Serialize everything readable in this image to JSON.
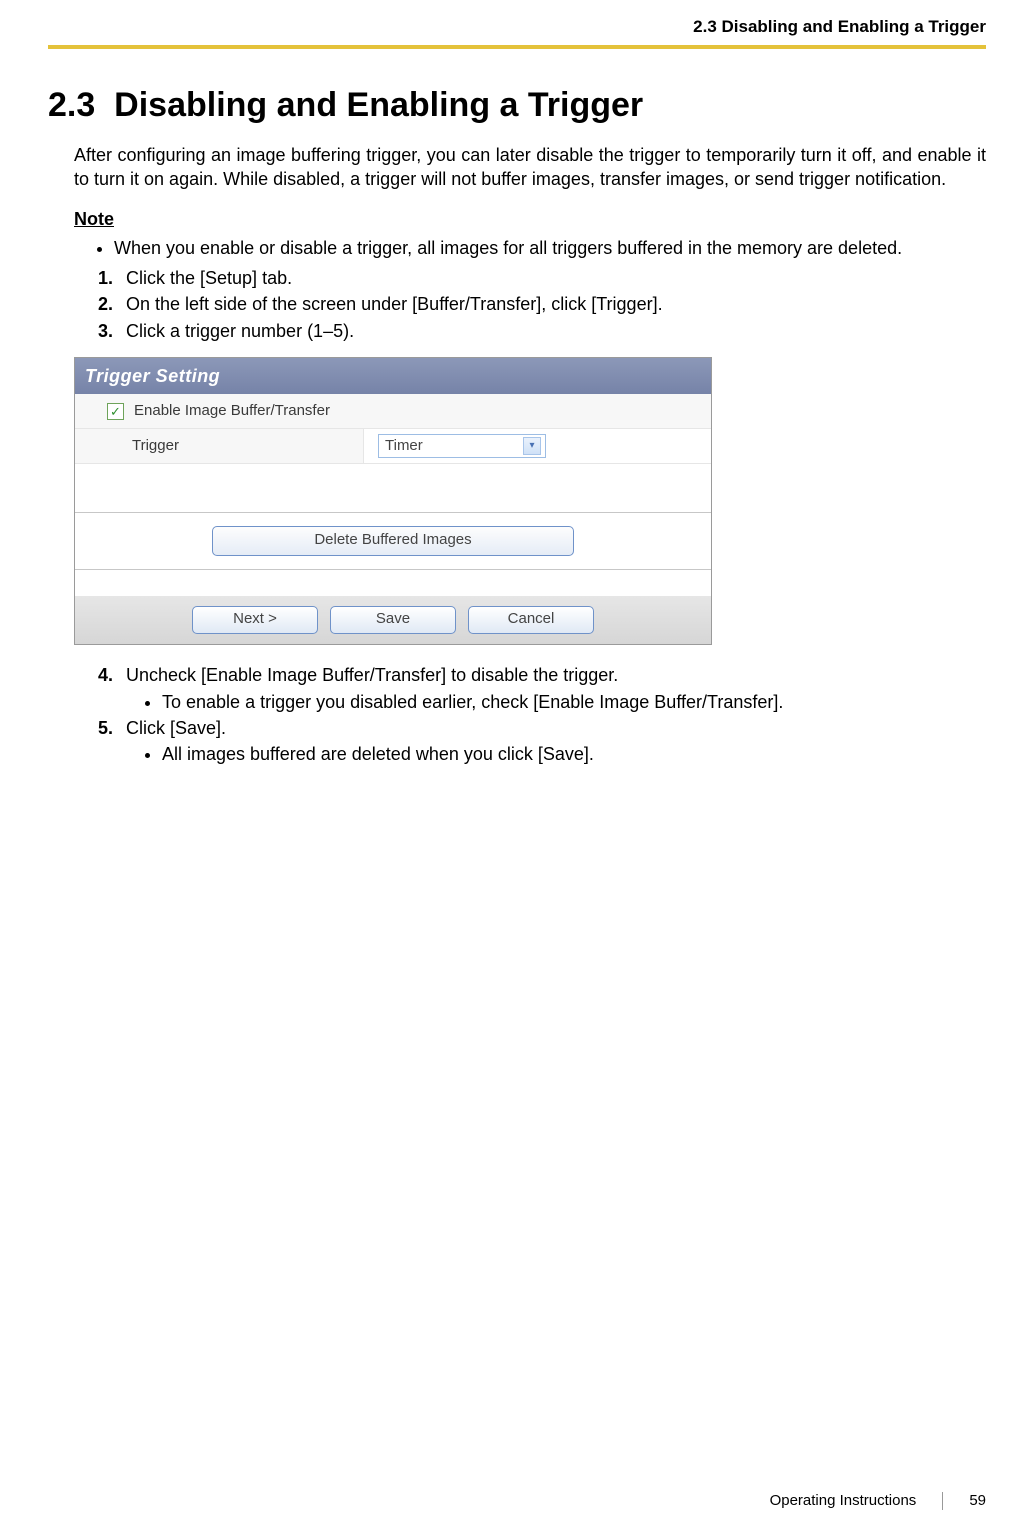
{
  "header": {
    "running": "2.3 Disabling and Enabling a Trigger"
  },
  "section": {
    "number": "2.3",
    "title": "Disabling and Enabling a Trigger",
    "intro": "After configuring an image buffering trigger, you can later disable the trigger to temporarily turn it off, and enable it to turn it on again. While disabled, a trigger will not buffer images, transfer images, or send trigger notification."
  },
  "note": {
    "label": "Note",
    "items": [
      "When you enable or disable a trigger, all images for all triggers buffered in the memory are deleted."
    ]
  },
  "steps": {
    "s1": "Click the [Setup] tab.",
    "s2": "On the left side of the screen under [Buffer/Transfer], click [Trigger].",
    "s3": "Click a trigger number (1–5).",
    "s4": "Uncheck [Enable Image Buffer/Transfer] to disable the trigger.",
    "s4b": "To enable a trigger you disabled earlier, check [Enable Image Buffer/Transfer].",
    "s5": "Click [Save].",
    "s5b": "All images buffered are deleted when you click [Save]."
  },
  "panel": {
    "title": "Trigger Setting",
    "enable_label": "Enable Image Buffer/Transfer",
    "trigger_label": "Trigger",
    "trigger_value": "Timer",
    "delete_btn": "Delete Buffered Images",
    "next_btn": "Next >",
    "save_btn": "Save",
    "cancel_btn": "Cancel"
  },
  "footer": {
    "doc": "Operating Instructions",
    "page": "59"
  }
}
